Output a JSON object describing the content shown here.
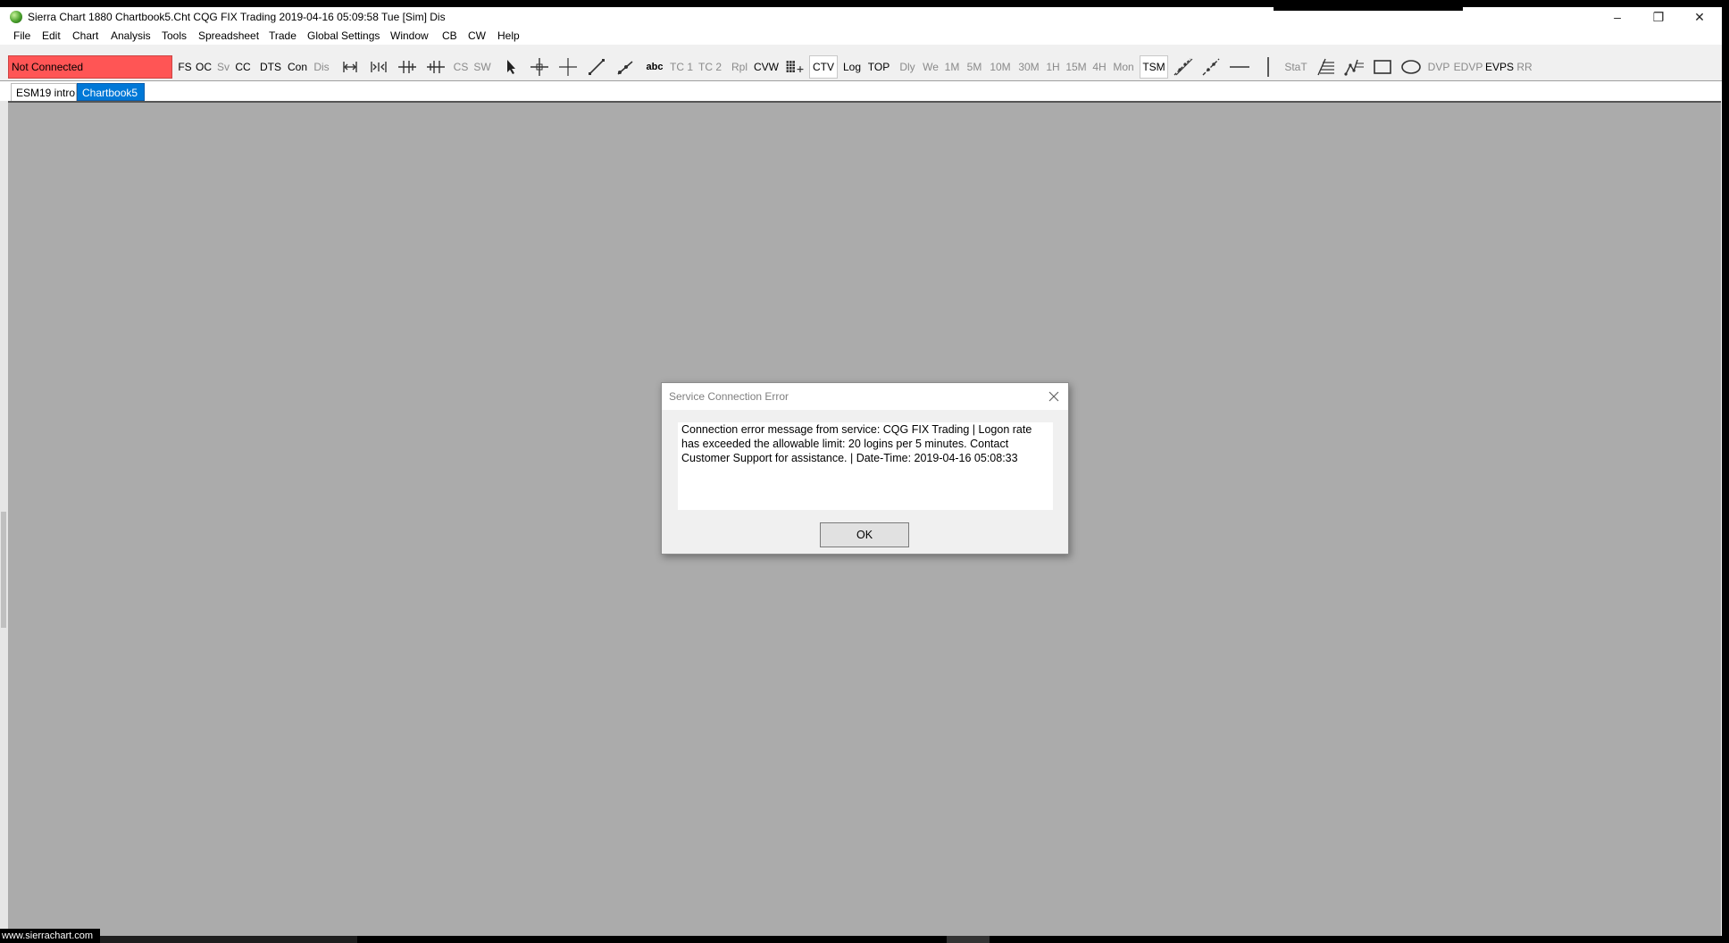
{
  "window": {
    "title": "Sierra Chart 1880 Chartbook5.Cht  CQG FIX Trading 2019-04-16  05:09:58 Tue [Sim]  Dis",
    "min_glyph": "–",
    "max_glyph": "❐",
    "close_glyph": "✕"
  },
  "menu": [
    "File",
    "Edit",
    "Chart",
    "Analysis",
    "Tools",
    "Spreadsheet",
    "Trade",
    "Global Settings",
    "Window",
    "CB",
    "CW",
    "Help"
  ],
  "toolbar": {
    "connection_status": "Not Connected",
    "status_color": "#ff5555",
    "btn_fs": "FS",
    "btn_oc": "OC",
    "btn_sv": "Sv",
    "btn_cc": "CC",
    "btn_dts": "DTS",
    "btn_con": "Con",
    "btn_dis": "Dis",
    "btn_cs": "CS",
    "btn_sw": "SW",
    "btn_abc": "abc",
    "btn_tc1": "TC 1",
    "btn_tc2": "TC 2",
    "btn_rpl": "Rpl",
    "btn_cvw": "CVW",
    "btn_ctv": "CTV",
    "btn_log": "Log",
    "btn_top": "TOP",
    "btn_dly": "Dly",
    "btn_we": "We",
    "btn_1m": "1M",
    "btn_5m": "5M",
    "btn_10m": "10M",
    "btn_30m": "30M",
    "btn_1h": "1H",
    "btn_15m": "15M",
    "btn_4h": "4H",
    "btn_mon": "Mon",
    "btn_tsm": "TSM",
    "btn_stat": "StaT",
    "btn_dvp": "DVP",
    "btn_edvp": "EDVP",
    "btn_evps": "EVPS",
    "btn_rr": "RR"
  },
  "tabs": [
    {
      "label": "ESM19 intro",
      "active": false
    },
    {
      "label": "Chartbook5",
      "active": true
    }
  ],
  "dialog": {
    "title": "Service Connection Error",
    "message": "Connection error message from service: CQG FIX Trading | Logon rate has exceeded the allowable limit: 20 logins per 5 minutes. Contact Customer Support for assistance. | Date-Time: 2019-04-16  05:08:33",
    "ok_label": "OK"
  },
  "statusbar": {
    "url": "www.sierrachart.com"
  }
}
